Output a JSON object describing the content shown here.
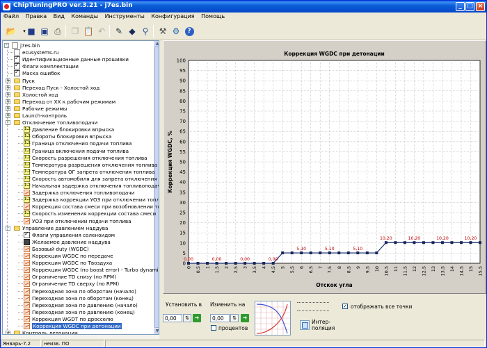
{
  "window": {
    "title": "ChipTuningPRO ver.3.21 - j7es.bin"
  },
  "menu": [
    "Файл",
    "Правка",
    "Вид",
    "Команды",
    "Инструменты",
    "Конфигурация",
    "Помощь"
  ],
  "toolbar_icons": [
    "open-folder-icon",
    "save-icon",
    "save-as-icon",
    "print-icon",
    "copy-icon",
    "paste-icon",
    "undo-icon",
    "edit-map-icon",
    "compare-icon",
    "search-icon",
    "tools-icon",
    "checksum-icon",
    "help-icon"
  ],
  "tree": {
    "root": "j7es.bin",
    "items": [
      {
        "label": "ecusystems.ru",
        "icon": "doc",
        "level": 1
      },
      {
        "label": "Идентификационные данные прошивки",
        "icon": "flag",
        "level": 1
      },
      {
        "label": "Флаги комплектации",
        "icon": "flag",
        "level": 1
      },
      {
        "label": "Маска ошибок",
        "icon": "flag",
        "level": 1
      },
      {
        "label": "Пуск",
        "icon": "folder",
        "level": 1,
        "expander": "+"
      },
      {
        "label": "Переход Пуск - Холостой ход",
        "icon": "folder",
        "level": 1,
        "expander": "+"
      },
      {
        "label": "Холостой ход",
        "icon": "folder",
        "level": 1,
        "expander": "+"
      },
      {
        "label": "Переход от XX к рабочим режимам",
        "icon": "folder",
        "level": 1,
        "expander": "+"
      },
      {
        "label": "Рабочие режимы",
        "icon": "folder",
        "level": 1,
        "expander": "+"
      },
      {
        "label": "Launch-контроль",
        "icon": "folder",
        "level": 1,
        "expander": "+"
      },
      {
        "label": "Отключение топливоподачи",
        "icon": "folder",
        "level": 1,
        "expander": "-"
      },
      {
        "label": "Давление блокировки впрыска",
        "icon": "val",
        "level": 2
      },
      {
        "label": "Обороты блокировки впрыска",
        "icon": "val",
        "level": 2
      },
      {
        "label": "Граница отключения подачи топлива",
        "icon": "val",
        "level": 2
      },
      {
        "label": "Граница включения подачи топлива",
        "icon": "val",
        "level": 2
      },
      {
        "label": "Скорость разрешения отключения топлива",
        "icon": "val",
        "level": 2
      },
      {
        "label": "Температура разрешения отключения топлива",
        "icon": "val",
        "level": 2
      },
      {
        "label": "Температура ОГ запрета отключения топлива",
        "icon": "val",
        "level": 2
      },
      {
        "label": "Скорость автомобиля для запрета отключения топ",
        "icon": "val",
        "level": 2
      },
      {
        "label": "Начальная задержка отключения топливоподачи",
        "icon": "val",
        "level": 2
      },
      {
        "label": "Задержка отключения топливоподачи",
        "icon": "map",
        "level": 2
      },
      {
        "label": "Задержка коррекции УОЗ при отключении топлив",
        "icon": "val",
        "level": 2
      },
      {
        "label": "Коррекция состава смеси при возобновлении топл",
        "icon": "map",
        "level": 2
      },
      {
        "label": "Скорость изменения коррекции состава смеси",
        "icon": "val",
        "level": 2
      },
      {
        "label": "УОЗ при отключении подачи топлива",
        "icon": "map",
        "level": 2
      },
      {
        "label": "Управление давлением наддува",
        "icon": "folder",
        "level": 1,
        "expander": "-"
      },
      {
        "label": "Флаги управления соленоидом",
        "icon": "flag",
        "level": 2
      },
      {
        "label": "Желаемое давление наддува",
        "icon": "iron",
        "level": 2
      },
      {
        "label": "Базовый duty (WGDC)",
        "icon": "map",
        "level": 2
      },
      {
        "label": "Коррекция WGDC по передаче",
        "icon": "map",
        "level": 2
      },
      {
        "label": "Коррекция WGDC по Твоздуха",
        "icon": "map",
        "level": 2
      },
      {
        "label": "Коррекция WGDC (по boost error) - Turbo dynamics (",
        "icon": "map",
        "level": 2
      },
      {
        "label": "Ограничение TD снизу (по RPM)",
        "icon": "map",
        "level": 2
      },
      {
        "label": "Ограничение TD сверху (по RPM)",
        "icon": "map",
        "level": 2
      },
      {
        "label": "Переходная зона по оборотам (начало)",
        "icon": "map",
        "level": 2
      },
      {
        "label": "Переходная зона по оборотам (конец)",
        "icon": "map",
        "level": 2
      },
      {
        "label": "Переходная зона по давлению (начало)",
        "icon": "map",
        "level": 2
      },
      {
        "label": "Переходная зона по давлению (конец)",
        "icon": "map",
        "level": 2
      },
      {
        "label": "Коррекция WGDT по дросселю",
        "icon": "map",
        "level": 2
      },
      {
        "label": "Коррекция WGDC при детонации",
        "icon": "map",
        "level": 2,
        "selected": true
      },
      {
        "label": "Контроль детонации",
        "icon": "folder",
        "level": 1,
        "expander": "+"
      }
    ]
  },
  "status": {
    "left": "Январь-7.2",
    "mid": "неизв. ПО"
  },
  "chart_data": {
    "type": "line",
    "title": "Коррекция WGDC при детонации",
    "xlabel": "Отскок угла",
    "ylabel": "Коррекция WGDC, %",
    "ylim": [
      0,
      100
    ],
    "yticks": [
      0,
      5,
      10,
      15,
      20,
      25,
      30,
      35,
      40,
      45,
      50,
      55,
      60,
      65,
      70,
      75,
      80,
      85,
      90,
      95,
      100
    ],
    "x": [
      "0",
      "0,5",
      "1",
      "1,5",
      "2",
      "2,5",
      "3",
      "3,5",
      "4",
      "4,5",
      "5",
      "5,5",
      "6",
      "6,5",
      "7",
      "7,5",
      "8",
      "8,5",
      "9",
      "9,5",
      "10",
      "10,5",
      "11",
      "11,5",
      "12",
      "12,5",
      "13",
      "13,5",
      "14",
      "14,5",
      "15",
      "15,5"
    ],
    "values": [
      0,
      0,
      0,
      0,
      0,
      0,
      0,
      0,
      0,
      0,
      5.1,
      5.1,
      5.1,
      5.1,
      5.1,
      5.1,
      5.1,
      5.1,
      5.1,
      5.1,
      5.1,
      10.2,
      10.2,
      10.2,
      10.2,
      10.2,
      10.2,
      10.2,
      10.2,
      10.2,
      10.2,
      10.2
    ],
    "data_labels": [
      {
        "index": 0,
        "text": "0,00"
      },
      {
        "index": 3,
        "text": "0,00"
      },
      {
        "index": 6,
        "text": "0,00"
      },
      {
        "index": 9,
        "text": "0,00"
      },
      {
        "index": 12,
        "text": "5,10"
      },
      {
        "index": 15,
        "text": "5,10"
      },
      {
        "index": 18,
        "text": "5,10"
      },
      {
        "index": 21,
        "text": "10,20"
      },
      {
        "index": 24,
        "text": "10,20"
      },
      {
        "index": 27,
        "text": "10,20"
      },
      {
        "index": 30,
        "text": "10,20"
      }
    ],
    "grid": true,
    "colors": {
      "line": "#1f2f6f",
      "marker": "#16285a",
      "label": "#c00000",
      "plot_bg": "#ffffff",
      "grid": "#b0b0b0"
    }
  },
  "controls": {
    "set_label": "Установить в",
    "set_value": "0,00",
    "change_label": "Изменить на",
    "change_value": "0,00",
    "percent_label": "процентов",
    "interp_label_1": "Интер-",
    "interp_label_2": "поляция",
    "show_all_label": "отображать все точки",
    "show_all_checked": true
  }
}
